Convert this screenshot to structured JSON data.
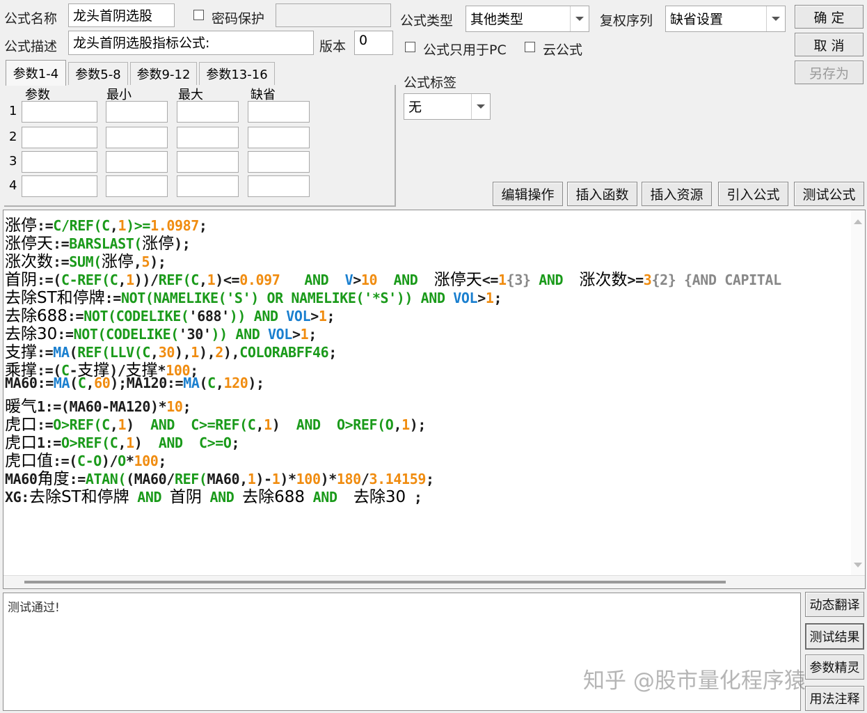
{
  "form": {
    "name_label": "公式名称",
    "name_value": "龙头首阴选股",
    "password_label": "密码保护",
    "desc_label": "公式描述",
    "desc_value": "龙头首阴选股指标公式:",
    "version_label": "版本",
    "version_value": "0",
    "type_label": "公式类型",
    "type_value": "其他类型",
    "rights_label": "复权序列",
    "rights_value": "缺省设置",
    "pc_only_label": "公式只用于PC",
    "cloud_label": "云公式",
    "tag_label": "公式标签",
    "tag_value": "无"
  },
  "buttons": {
    "ok": "确  定",
    "cancel": "取  消",
    "save_as": "另存为",
    "edit_ops": "编辑操作",
    "insert_func": "插入函数",
    "insert_res": "插入资源",
    "import_formula": "引入公式",
    "test_formula": "测试公式",
    "dyn_translate": "动态翻译",
    "test_result": "测试结果",
    "param_wizard": "参数精灵",
    "usage_notes": "用法注释"
  },
  "tabs": [
    "参数1-4",
    "参数5-8",
    "参数9-12",
    "参数13-16"
  ],
  "param_grid": {
    "headers": [
      "参数",
      "最小",
      "最大",
      "缺省"
    ],
    "rows": [
      "1",
      "2",
      "3",
      "4"
    ]
  },
  "code_lines": [
    [
      [
        "cn",
        "涨停"
      ],
      [
        "k",
        ":="
      ],
      [
        "g",
        "C/REF("
      ],
      [
        "g",
        "C"
      ],
      [
        "k",
        ","
      ],
      [
        "o",
        "1"
      ],
      [
        "g",
        ")>="
      ],
      [
        "o",
        "1.0987"
      ],
      [
        "k",
        ";"
      ]
    ],
    [
      [
        "cn",
        "涨停天"
      ],
      [
        "k",
        ":="
      ],
      [
        "g",
        "BARSLAST("
      ],
      [
        "cn",
        "涨停"
      ],
      [
        "k",
        ");"
      ]
    ],
    [
      [
        "cn",
        "涨次数"
      ],
      [
        "k",
        ":="
      ],
      [
        "g",
        "SUM("
      ],
      [
        "cn",
        "涨停"
      ],
      [
        "k",
        ","
      ],
      [
        "o",
        "5"
      ],
      [
        "k",
        ");"
      ]
    ],
    [
      [
        "cn",
        "首阴"
      ],
      [
        "k",
        ":=("
      ],
      [
        "g",
        "C-REF("
      ],
      [
        "g",
        "C"
      ],
      [
        "k",
        ","
      ],
      [
        "o",
        "1"
      ],
      [
        "k",
        "))/"
      ],
      [
        "g",
        "REF("
      ],
      [
        "g",
        "C"
      ],
      [
        "k",
        ","
      ],
      [
        "o",
        "1"
      ],
      [
        "k",
        ")<="
      ],
      [
        "o",
        "0.097"
      ],
      [
        "k",
        "   "
      ],
      [
        "g",
        "AND"
      ],
      [
        "k",
        "  "
      ],
      [
        "b",
        "V"
      ],
      [
        "k",
        ">"
      ],
      [
        "o",
        "10"
      ],
      [
        "k",
        "  "
      ],
      [
        "g",
        "AND"
      ],
      [
        "k",
        "  "
      ],
      [
        "cn",
        "涨停天"
      ],
      [
        "k",
        "<="
      ],
      [
        "o",
        "1"
      ],
      [
        "gr",
        "{3}"
      ],
      [
        "k",
        " "
      ],
      [
        "g",
        "AND"
      ],
      [
        "k",
        "  "
      ],
      [
        "cn",
        "涨次数"
      ],
      [
        "k",
        ">="
      ],
      [
        "o",
        "3"
      ],
      [
        "gr",
        "{2} {AND CAPITAL"
      ]
    ],
    [
      [
        "cn",
        "去除ST和停牌"
      ],
      [
        "k",
        ":="
      ],
      [
        "g",
        "NOT(NAMELIKE('S') OR NAMELIKE('*S')) AND"
      ],
      [
        "k",
        " "
      ],
      [
        "b",
        "VOL"
      ],
      [
        "k",
        ">"
      ],
      [
        "o",
        "1"
      ],
      [
        "k",
        ";"
      ]
    ],
    [
      [
        "cn",
        "去除688"
      ],
      [
        "k",
        ":="
      ],
      [
        "g",
        "NOT(CODELIKE("
      ],
      [
        "k",
        "'688'"
      ],
      [
        "g",
        ")) AND"
      ],
      [
        "k",
        " "
      ],
      [
        "b",
        "VOL"
      ],
      [
        "k",
        ">"
      ],
      [
        "o",
        "1"
      ],
      [
        "k",
        ";"
      ]
    ],
    [
      [
        "cn",
        "去除30"
      ],
      [
        "k",
        ":="
      ],
      [
        "g",
        "NOT(CODELIKE("
      ],
      [
        "k",
        "'30'"
      ],
      [
        "g",
        ")) AND"
      ],
      [
        "k",
        " "
      ],
      [
        "b",
        "VOL"
      ],
      [
        "k",
        ">"
      ],
      [
        "o",
        "1"
      ],
      [
        "k",
        ";"
      ]
    ],
    [
      [
        "cn",
        "支撑"
      ],
      [
        "k",
        ":="
      ],
      [
        "b",
        "MA"
      ],
      [
        "k",
        "("
      ],
      [
        "g",
        "REF(LLV("
      ],
      [
        "g",
        "C"
      ],
      [
        "k",
        ","
      ],
      [
        "o",
        "30"
      ],
      [
        "k",
        "),"
      ],
      [
        "o",
        "1"
      ],
      [
        "k",
        "),"
      ],
      [
        "o",
        "2"
      ],
      [
        "k",
        "),"
      ],
      [
        "g",
        "COLORABFF46"
      ],
      [
        "k",
        ";"
      ]
    ],
    [
      [
        "cn",
        "乘撑"
      ],
      [
        "k",
        ":=("
      ],
      [
        "g",
        "C"
      ],
      [
        "k",
        "-"
      ],
      [
        "cn",
        "支撑"
      ],
      [
        "k",
        ")/"
      ],
      [
        "cn",
        "支撑"
      ],
      [
        "k",
        "*"
      ],
      [
        "o",
        "100"
      ],
      [
        "k",
        ";"
      ]
    ],
    [
      [
        "k",
        "MA60:="
      ],
      [
        "b",
        "MA"
      ],
      [
        "k",
        "("
      ],
      [
        "g",
        "C"
      ],
      [
        "k",
        ","
      ],
      [
        "o",
        "60"
      ],
      [
        "k",
        ");MA120:="
      ],
      [
        "b",
        "MA"
      ],
      [
        "k",
        "("
      ],
      [
        "g",
        "C"
      ],
      [
        "k",
        ","
      ],
      [
        "o",
        "120"
      ],
      [
        "k",
        ");"
      ]
    ],
    [
      [
        "cn",
        "暖气"
      ],
      [
        "k",
        "1:=(MA60-MA120)*"
      ],
      [
        "o",
        "10"
      ],
      [
        "k",
        ";"
      ]
    ],
    [
      [
        "cn",
        "虎口"
      ],
      [
        "k",
        ":="
      ],
      [
        "g",
        "O>REF("
      ],
      [
        "g",
        "C"
      ],
      [
        "k",
        ","
      ],
      [
        "o",
        "1"
      ],
      [
        "k",
        ")  "
      ],
      [
        "g",
        "AND"
      ],
      [
        "k",
        "  "
      ],
      [
        "g",
        "C>=REF("
      ],
      [
        "g",
        "C"
      ],
      [
        "k",
        ","
      ],
      [
        "o",
        "1"
      ],
      [
        "k",
        ")  "
      ],
      [
        "g",
        "AND"
      ],
      [
        "k",
        "  "
      ],
      [
        "g",
        "O>REF("
      ],
      [
        "g",
        "O"
      ],
      [
        "k",
        ","
      ],
      [
        "o",
        "1"
      ],
      [
        "k",
        ");"
      ]
    ],
    [
      [
        "cn",
        "虎口"
      ],
      [
        "k",
        "1:="
      ],
      [
        "g",
        "O>REF("
      ],
      [
        "g",
        "C"
      ],
      [
        "k",
        ","
      ],
      [
        "o",
        "1"
      ],
      [
        "k",
        ")  "
      ],
      [
        "g",
        "AND"
      ],
      [
        "k",
        "  "
      ],
      [
        "g",
        "C>=O"
      ],
      [
        "k",
        ";"
      ]
    ],
    [
      [
        "cn",
        "虎口值"
      ],
      [
        "k",
        ":=("
      ],
      [
        "g",
        "C-O"
      ],
      [
        "k",
        ")/"
      ],
      [
        "g",
        "O"
      ],
      [
        "k",
        "*"
      ],
      [
        "o",
        "100"
      ],
      [
        "k",
        ";"
      ]
    ],
    [
      [
        "k",
        "MA60"
      ],
      [
        "cn",
        "角度"
      ],
      [
        "k",
        ":="
      ],
      [
        "g",
        "ATAN("
      ],
      [
        "k",
        "(MA60/"
      ],
      [
        "g",
        "REF("
      ],
      [
        "k",
        "MA60,"
      ],
      [
        "o",
        "1"
      ],
      [
        "k",
        ")-"
      ],
      [
        "o",
        "1"
      ],
      [
        "k",
        ")*"
      ],
      [
        "o",
        "100"
      ],
      [
        "k",
        ")*"
      ],
      [
        "o",
        "180"
      ],
      [
        "k",
        "/"
      ],
      [
        "o",
        "3.14159"
      ],
      [
        "k",
        ";"
      ]
    ],
    [
      [
        "k",
        "XG:"
      ],
      [
        "cn",
        "去除ST和停牌"
      ],
      [
        "k",
        " "
      ],
      [
        "g",
        "AND"
      ],
      [
        "k",
        " "
      ],
      [
        "cn",
        "首阴"
      ],
      [
        "k",
        " "
      ],
      [
        "g",
        "AND"
      ],
      [
        "k",
        " "
      ],
      [
        "cn",
        "去除688"
      ],
      [
        "k",
        " "
      ],
      [
        "g",
        "AND"
      ],
      [
        "k",
        "  "
      ],
      [
        "cn",
        "去除30"
      ],
      [
        "k",
        " ;"
      ]
    ]
  ],
  "result_text": "测试通过!",
  "watermark": "知乎 @股市量化程序猿"
}
